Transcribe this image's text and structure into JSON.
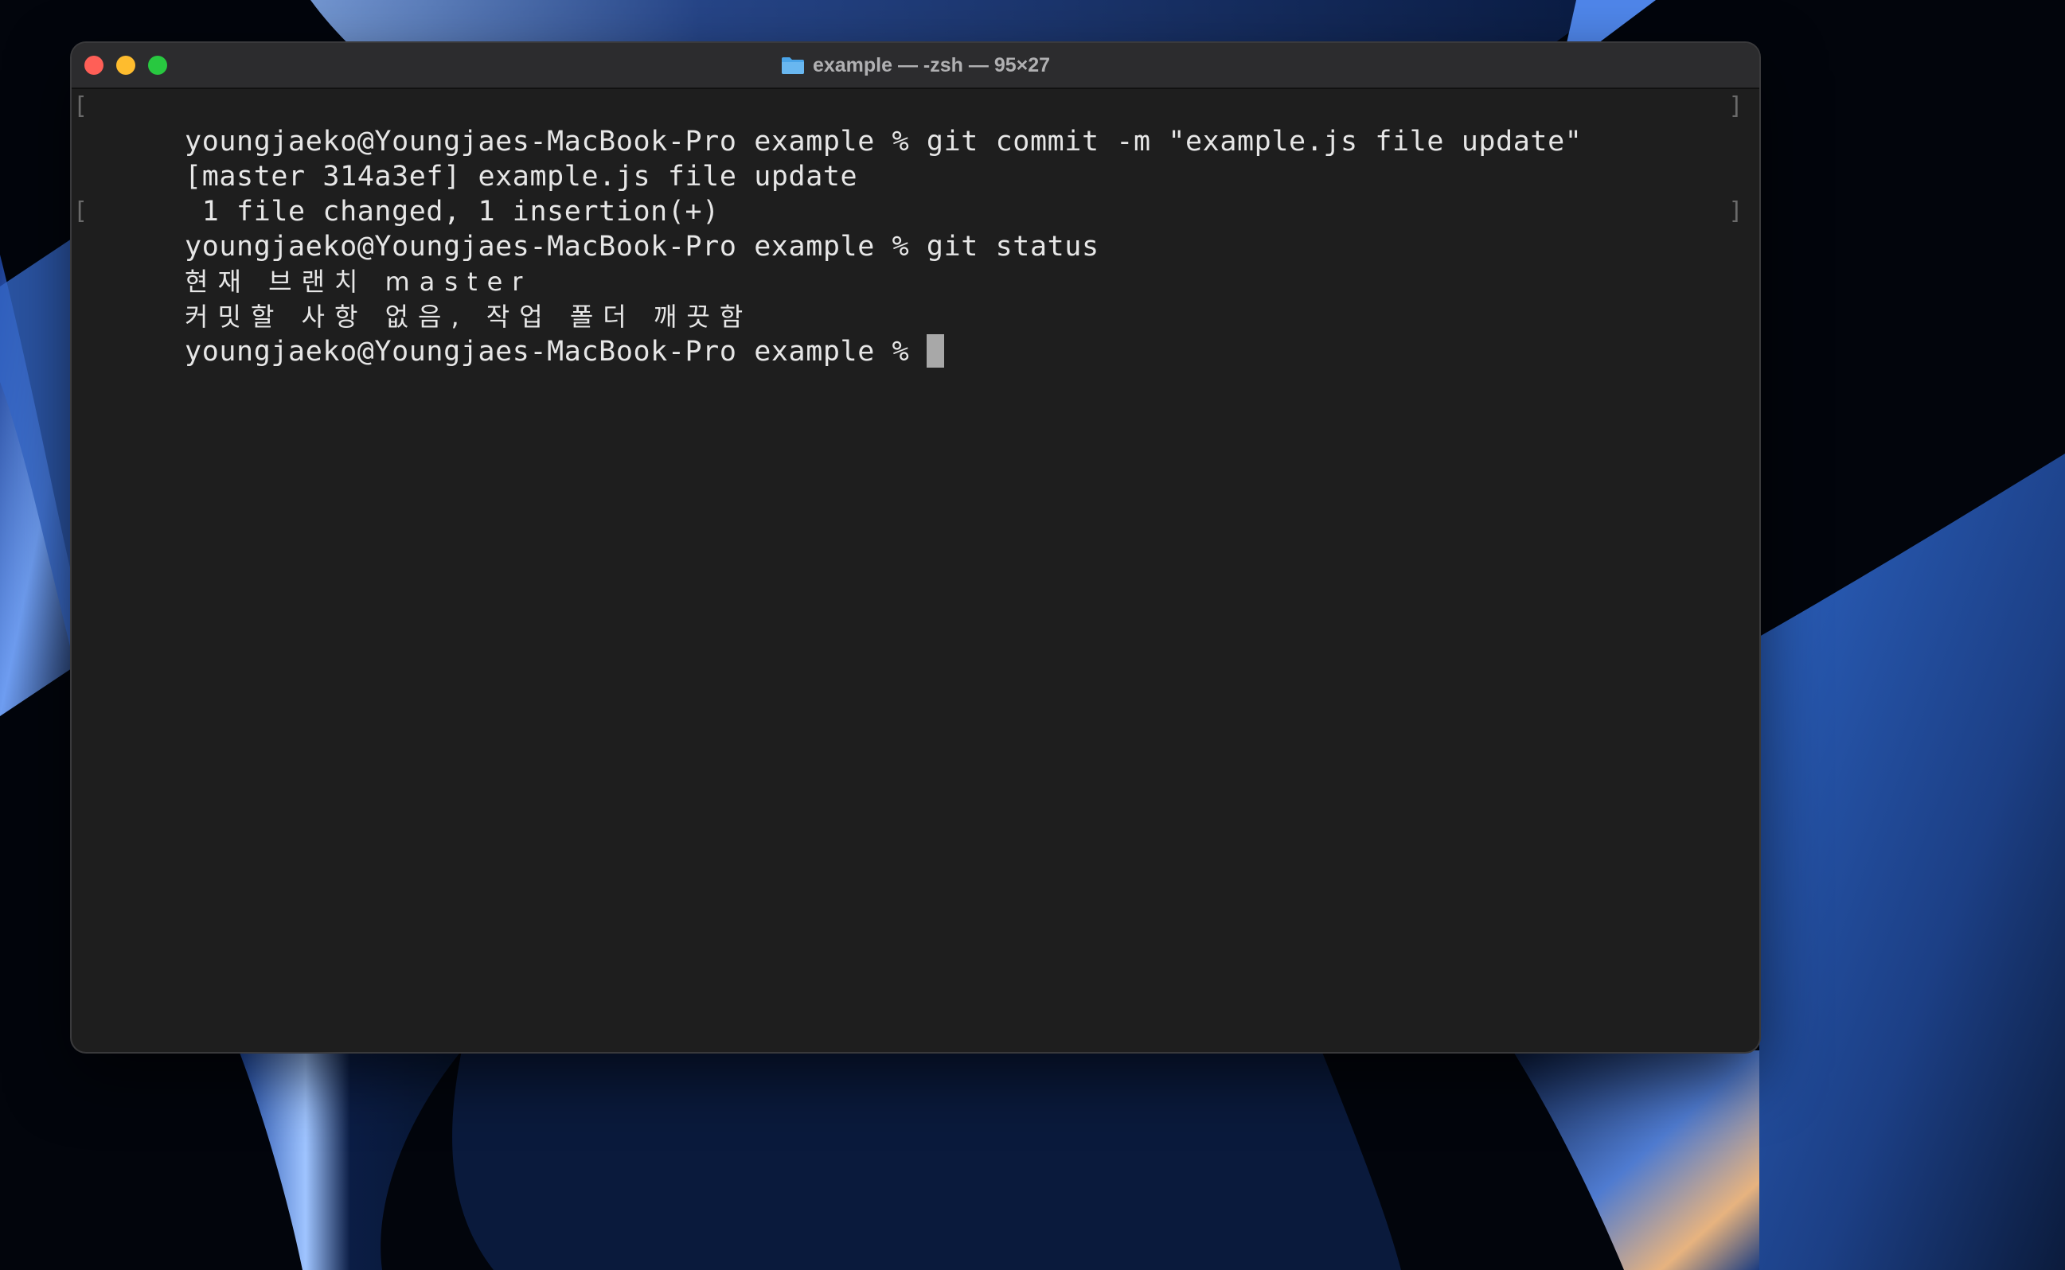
{
  "window": {
    "title": "example — -zsh — 95×27",
    "folder_icon": "folder-icon"
  },
  "terminal": {
    "lines": [
      "youngjaeko@Youngjaes-MacBook-Pro example % git commit -m \"example.js file update\"",
      "[master 314a3ef] example.js file update",
      " 1 file changed, 1 insertion(+)",
      "youngjaeko@Youngjaes-MacBook-Pro example % git status",
      "현재 브랜치 master",
      "커밋할 사항 없음, 작업 폴더 깨끗함",
      "youngjaeko@Youngjaes-MacBook-Pro example % "
    ]
  },
  "colors": {
    "close": "#ff5f57",
    "minimize": "#febc2e",
    "zoom": "#28c840",
    "terminal_bg": "#1e1e1e",
    "terminal_text": "#e6e6e6"
  }
}
